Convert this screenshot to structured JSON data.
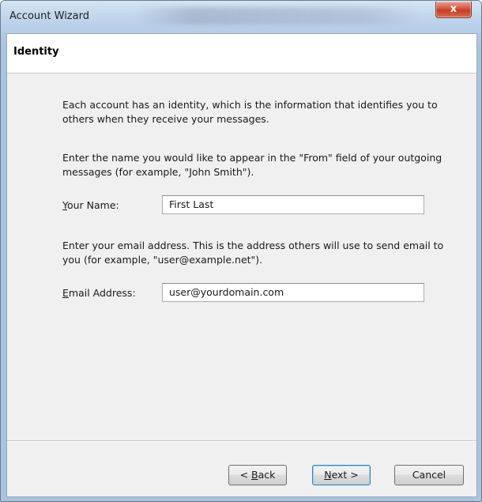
{
  "window": {
    "title": "Account Wizard",
    "close_label": "x"
  },
  "header": {
    "title": "Identity"
  },
  "content": {
    "intro": "Each account has an identity, which is the information that identifies you to others when they receive your messages.",
    "name_instructions": "Enter the name you would like to appear in the \"From\" field of your outgoing messages (for example, \"John Smith\").",
    "name_label_accel": "Y",
    "name_label_rest": "our Name:",
    "name_value": "First Last",
    "email_instructions": "Enter your email address. This is the address others will use to send email to you (for example, \"user@example.net\").",
    "email_label_accel": "E",
    "email_label_rest": "mail Address:",
    "email_value": "user@yourdomain.com"
  },
  "buttons": {
    "back_prefix": "< ",
    "back_accel": "B",
    "back_rest": "ack",
    "next_accel": "N",
    "next_rest": "ext >",
    "cancel": "Cancel"
  }
}
